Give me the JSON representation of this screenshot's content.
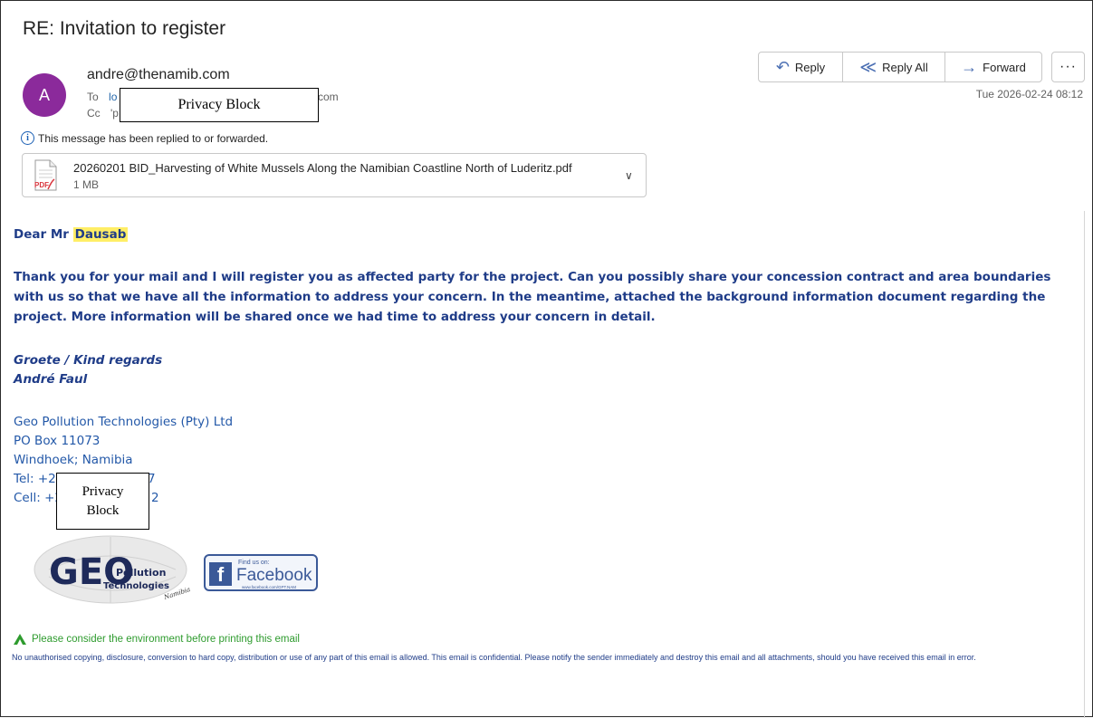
{
  "email": {
    "subject": "RE: Invitation to register",
    "avatar_initial": "A",
    "from": "andre@thenamib.com",
    "to_label": "To",
    "to_value": "lo",
    "to_suffix": "com",
    "cc_label": "Cc",
    "cc_value": "'p",
    "privacy_block_header": "Privacy Block",
    "date": "Tue 2026-02-24 08:12",
    "info_notice": "This message has been replied to or forwarded."
  },
  "actions": {
    "reply": "Reply",
    "reply_all": "Reply All",
    "forward": "Forward",
    "more": "···"
  },
  "attachment": {
    "filename": "20260201 BID_Harvesting of White Mussels Along the Namibian Coastline North of Luderitz.pdf",
    "size": "1 MB",
    "icon_label": "PDF"
  },
  "body": {
    "greeting_prefix": "Dear Mr ",
    "greeting_name": "Dausab",
    "paragraph": "Thank you for your mail and I will register you as affected party for the project. Can you possibly share your concession contract and area boundaries with us so that we have all the information to address your concern.  In the meantime, attached the background information document regarding the project. More information will be shared once we had time to address your concern in detail.",
    "regards_line1": "Groete / Kind regards",
    "regards_line2": "André Faul"
  },
  "signature": {
    "company": "Geo Pollution Technologies (Pty) Ltd",
    "po_box": "PO Box 11073",
    "city": "Windhoek; Namibia",
    "tel": "Tel: +2",
    "cell": "Cell: +2",
    "cell_suffix": "2",
    "tel_suffix": "7",
    "privacy_block_line1": "Privacy",
    "privacy_block_line2": "Block",
    "logo_text_big": "GEO",
    "logo_text_1": "Pollution",
    "logo_text_2": "Technologies",
    "logo_text_3": "Namibia",
    "fb_small": "Find us on:",
    "fb_name": "Facebook",
    "fb_url": "www.facebook.com/GPT.NAM"
  },
  "footer": {
    "environment": "Please consider the environment before printing this email",
    "disclaimer": "No unauthorised copying, disclosure, conversion to hard copy, distribution or use of any part of this email is allowed. This email is confidential. Please notify the sender immediately and destroy this email and all attachments, should you have received this email in error."
  },
  "colors": {
    "avatar": "#8b2a9b",
    "body_text": "#1f3c88",
    "highlight": "#ffee66",
    "env_green": "#2e9b2e",
    "facebook": "#3b5998"
  }
}
